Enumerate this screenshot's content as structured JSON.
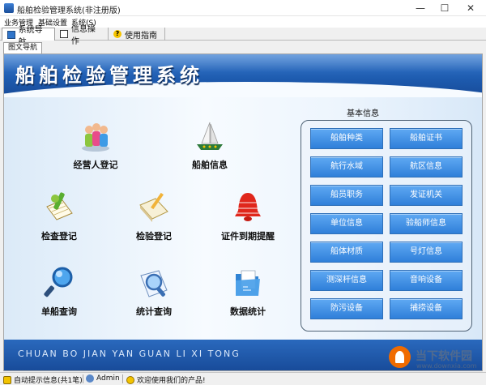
{
  "window": {
    "title": "船舶检验管理系统(非注册版)",
    "controls": {
      "minimize": "—",
      "maximize": "☐",
      "close": "✕"
    }
  },
  "menu": [
    "业务管理",
    "基础设置",
    "系统(S)"
  ],
  "tabs": [
    {
      "label": "系统导航",
      "icon": "monitor-icon",
      "active": true
    },
    {
      "label": "信息操作",
      "icon": "document-icon",
      "active": false
    },
    {
      "label": "使用指南",
      "icon": "help-icon",
      "active": false
    }
  ],
  "subtab": {
    "label": "图文导航"
  },
  "banner": {
    "title": "船舶检验管理系统",
    "pinyin": "CHUAN BO JIAN YAN GUAN LI XI TONG"
  },
  "functions": [
    {
      "label": "经营人登记",
      "icon": "people-icon"
    },
    {
      "label": "船舶信息",
      "icon": "ship-icon"
    },
    {
      "label": "检查登记",
      "icon": "clipboard-pencil-icon"
    },
    {
      "label": "检验登记",
      "icon": "notebook-pencil-icon"
    },
    {
      "label": "证件到期提醒",
      "icon": "bell-icon"
    },
    {
      "label": "单船查询",
      "icon": "magnifier-icon"
    },
    {
      "label": "统计查询",
      "icon": "magnifier-chart-icon"
    },
    {
      "label": "数据统计",
      "icon": "folder-icon"
    }
  ],
  "info": {
    "heading": "基本信息",
    "buttons": [
      "船舶种类",
      "船舶证书",
      "航行水域",
      "航区信息",
      "船员职务",
      "发证机关",
      "单位信息",
      "验船师信息",
      "船体材质",
      "号灯信息",
      "测深杆信息",
      "音响设备",
      "防污设备",
      "捕捞设备"
    ]
  },
  "status": {
    "tips": "自动提示信息(共1笔)",
    "user": "Admin",
    "welcome": "欢迎使用我们的产品!"
  },
  "watermark": {
    "name": "当下软件园",
    "url": "www.downxia.com"
  },
  "colors": {
    "banner": "#1e5cb0",
    "button_blue": "#3f8ee3",
    "panel_border": "#4f6275"
  }
}
